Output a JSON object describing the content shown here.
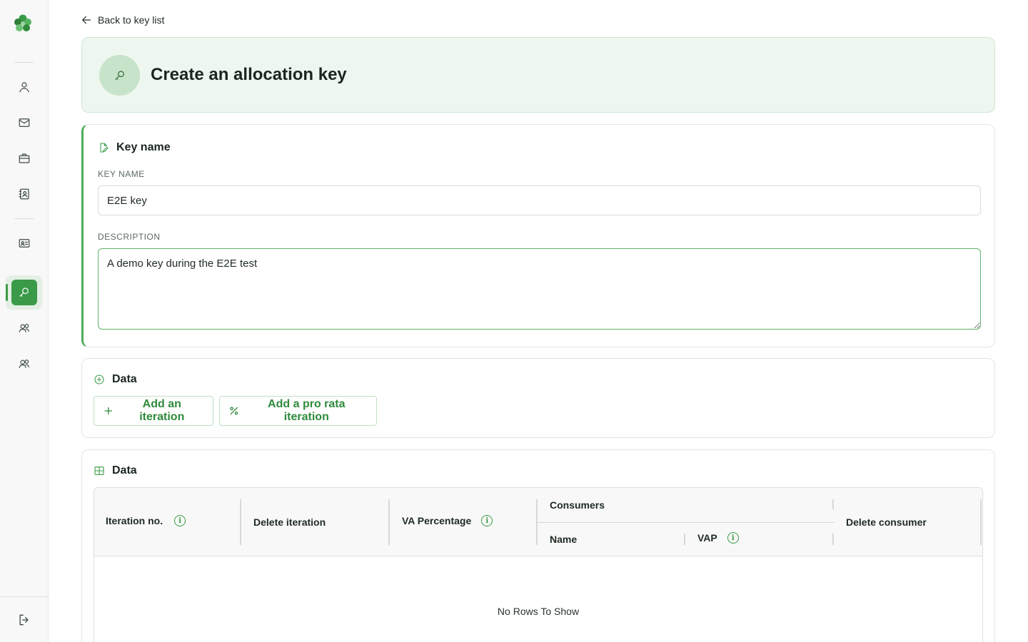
{
  "sidebar": {
    "logo": "clover-logo",
    "items": [
      {
        "icon": "user-icon",
        "active": false
      },
      {
        "icon": "mail-icon",
        "active": false
      },
      {
        "icon": "briefcase-icon",
        "active": false
      },
      {
        "icon": "contact-book-icon",
        "active": false
      },
      {
        "icon": "id-card-icon",
        "active": false
      },
      {
        "icon": "key-icon",
        "active": true
      },
      {
        "icon": "users-icon",
        "active": false
      },
      {
        "icon": "users-icon",
        "active": false
      }
    ],
    "logout_icon": "logout-icon",
    "accent_color": "#3a9a47"
  },
  "back_link": {
    "label": "Back to key list"
  },
  "header": {
    "title": "Create an allocation key",
    "icon": "key-icon"
  },
  "key_section": {
    "title": "Key name",
    "key_name_label": "KEY NAME",
    "key_name_value": "E2E key",
    "description_label": "DESCRIPTION",
    "description_value": "A demo key during the E2E test"
  },
  "data_actions": {
    "title": "Data",
    "add_iteration": "Add an iteration",
    "add_pro_rata": "Add a pro rata iteration"
  },
  "data_table": {
    "title": "Data",
    "columns": {
      "iteration_no": "Iteration no.",
      "delete_iteration": "Delete iteration",
      "va_percentage": "VA Percentage",
      "consumers": "Consumers",
      "name": "Name",
      "vap": "VAP",
      "delete_consumer": "Delete consumer"
    },
    "info_glyph": "i",
    "empty_message": "No Rows To Show"
  }
}
